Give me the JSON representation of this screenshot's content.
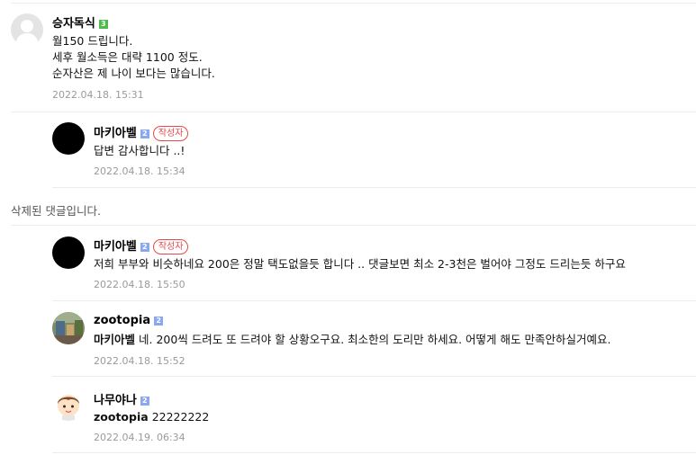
{
  "comments": [
    {
      "nickname": "승자독식",
      "level": "3",
      "lines": [
        "월150 드립니다.",
        "세후 월소득은 대략 1100 정도.",
        "순자산은 제 나이 보다는 많습니다."
      ],
      "date": "2022.04.18. 15:31"
    },
    {
      "nickname": "마키아벨",
      "level": "2",
      "author_badge": "작성자",
      "text": "답변 감사합니다 ..!",
      "date": "2022.04.18. 15:34"
    },
    {
      "deleted_text": "삭제된 댓글입니다."
    },
    {
      "nickname": "마키아벨",
      "level": "2",
      "author_badge": "작성자",
      "text": "저희 부부와 비슷하네요 200은 정말 택도없을듯 합니다 .. 댓글보면 최소 2-3천은 벌어야 그정도 드리는듯 하구요",
      "date": "2022.04.18. 15:50"
    },
    {
      "nickname": "zootopia",
      "level": "2",
      "mention": "마키아벨",
      "text": "네. 200씩 드려도 또 드려야 할 상황오구요. 최소한의 도리만 하세요. 어떻게 해도 만족안하실거예요.",
      "date": "2022.04.18. 15:52"
    },
    {
      "nickname": "나무야나",
      "level": "2",
      "mention": "zootopia",
      "text": "22222222",
      "date": "2022.04.19. 06:34"
    }
  ],
  "colors": {
    "date": "#9a9a9a",
    "author_badge": "#e8484b",
    "level_green": "#4cbb4a",
    "level_blue": "#8aa7f0",
    "divider": "#ececec"
  }
}
